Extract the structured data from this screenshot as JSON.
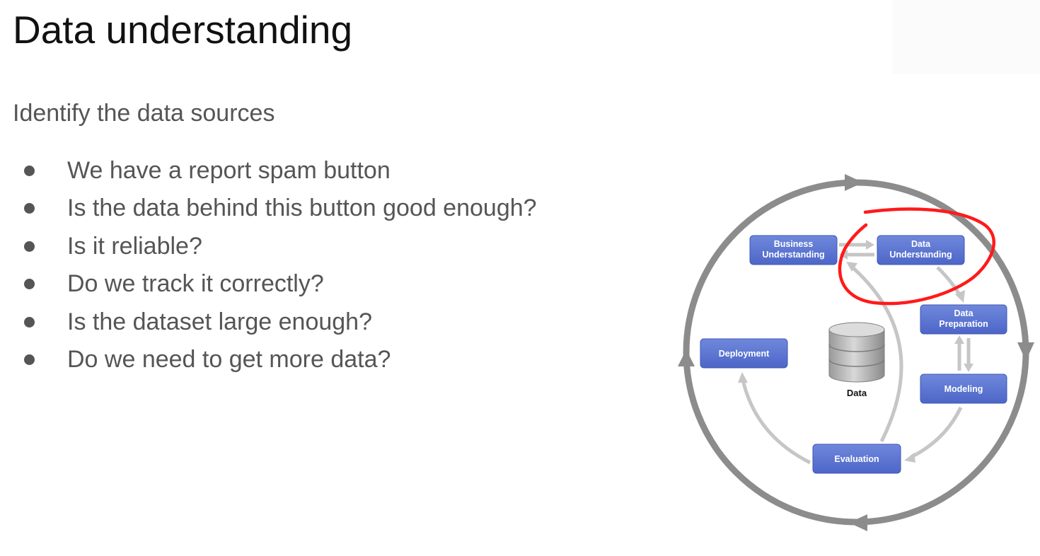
{
  "slide": {
    "title": "Data understanding",
    "subtitle": "Identify the data sources",
    "bullets": [
      "We have a report spam button",
      "Is the data behind this button good enough?",
      "Is it reliable?",
      "Do we track it correctly?",
      "Is the dataset large enough?",
      "Do we need to get more data?"
    ]
  },
  "diagram": {
    "phases": {
      "business_line1": "Business",
      "business_line2": "Understanding",
      "data_understanding_line1": "Data",
      "data_understanding_line2": "Understanding",
      "data_preparation_line1": "Data",
      "data_preparation_line2": "Preparation",
      "modeling": "Modeling",
      "evaluation": "Evaluation",
      "deployment": "Deployment"
    },
    "data_label": "Data",
    "colors": {
      "phase_box": "#5470d0",
      "outer_ring": "#8c8c8c",
      "inner_arrows": "#c6c6c6",
      "highlight_annotation": "#ff1a1a"
    }
  }
}
